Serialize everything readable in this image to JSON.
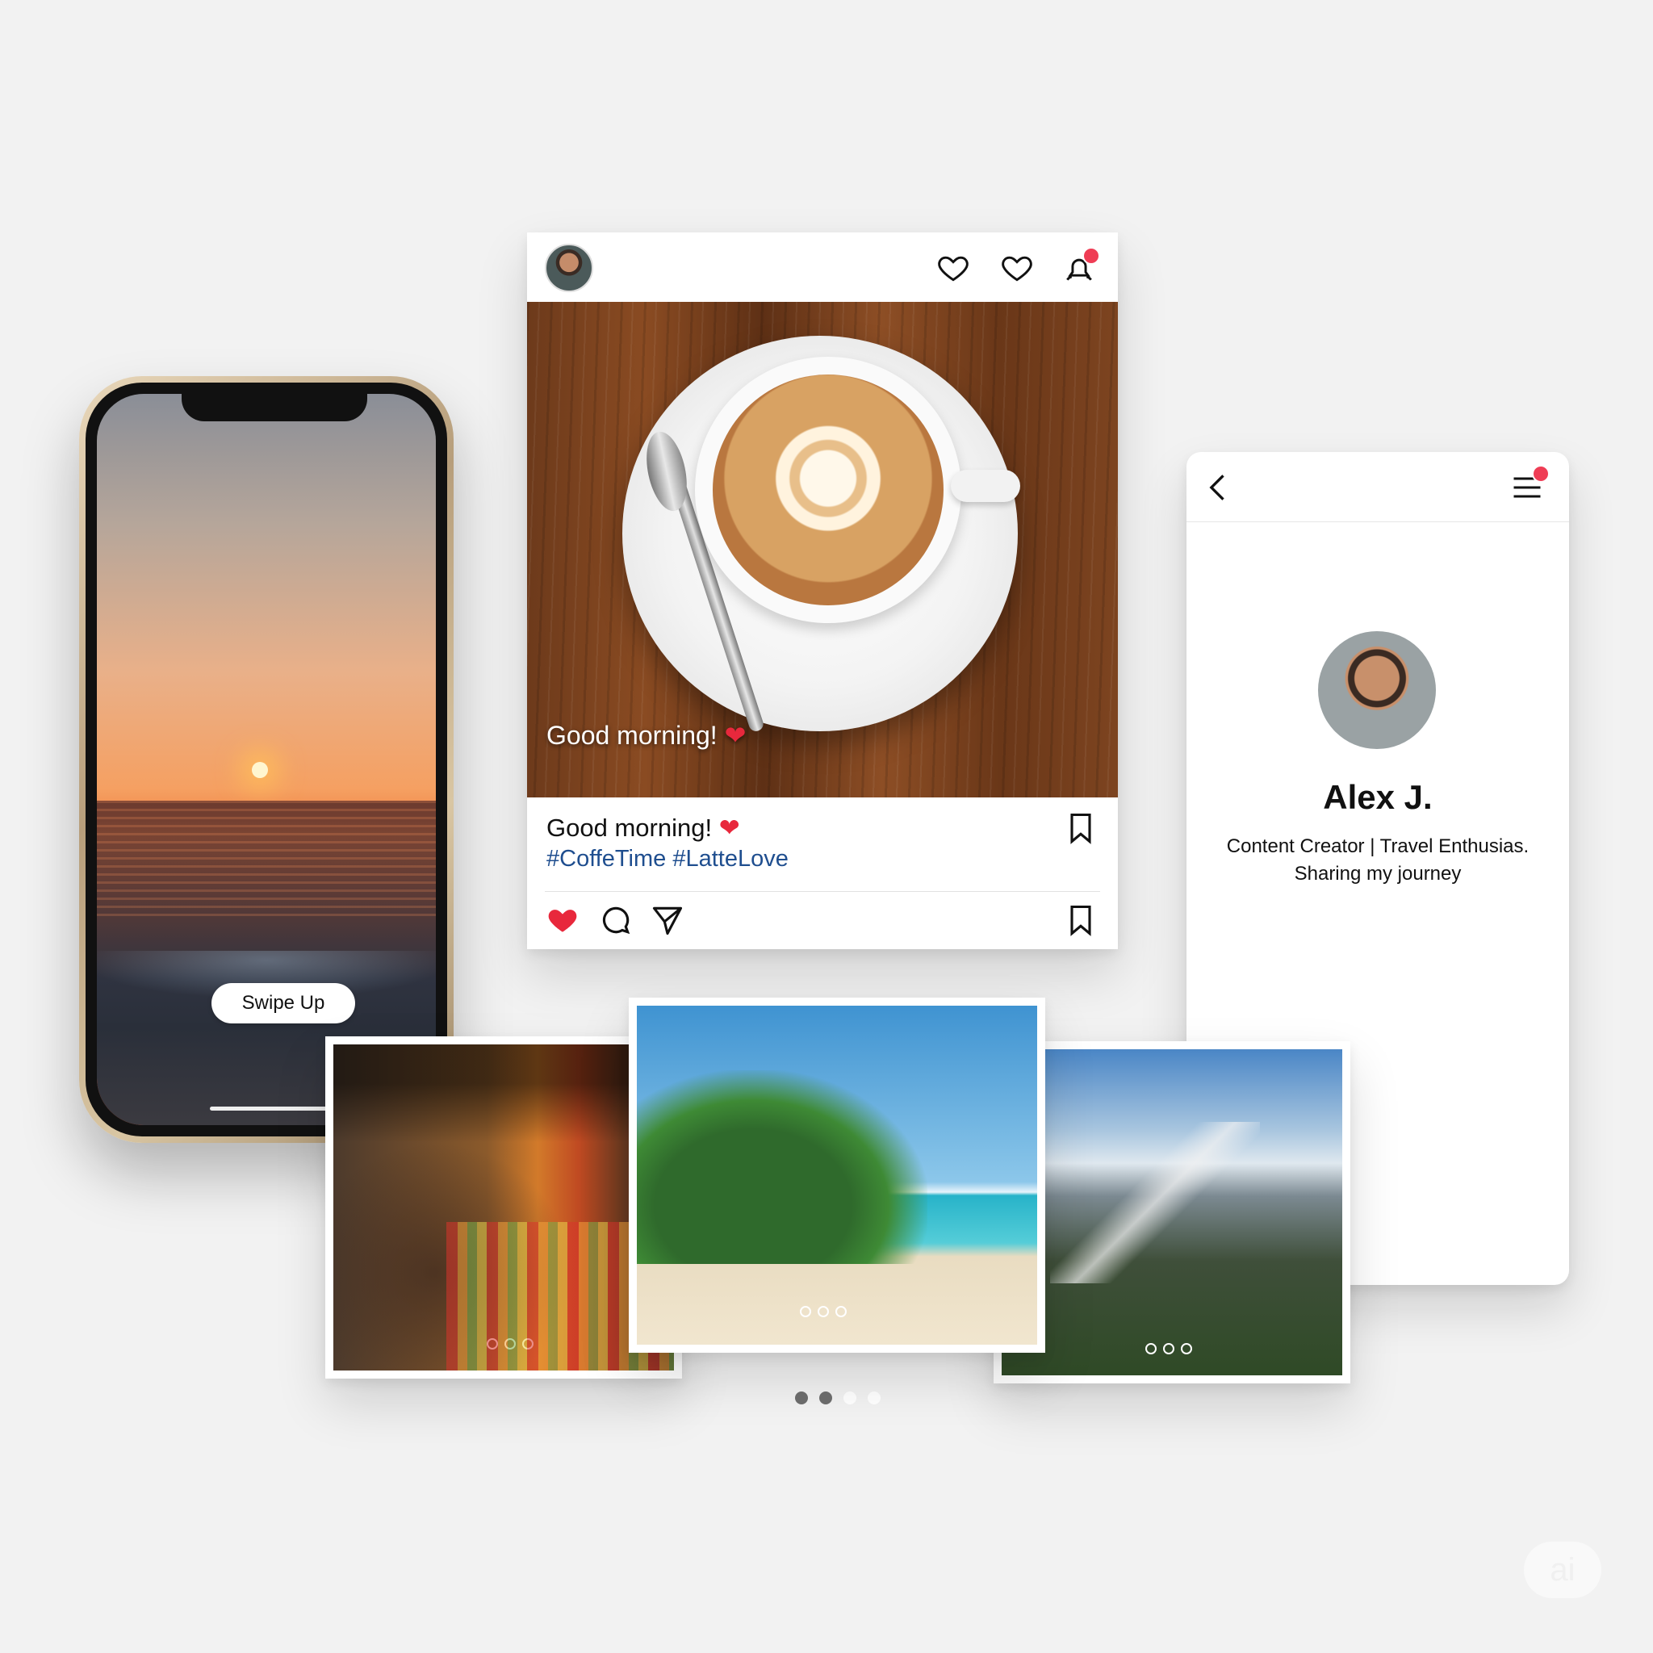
{
  "phone": {
    "swipe_label": "Swipe Up"
  },
  "post": {
    "header_icons": [
      "avatar",
      "heart-icon",
      "heart-icon",
      "notification-bell-icon"
    ],
    "image_overlay_caption": "Good morning!",
    "caption": "Good morning!",
    "hashtags": "#CoffeTime #LatteLove",
    "liked": true,
    "accent_color": "#e8283c",
    "hashtag_color": "#1f4e8f"
  },
  "profile": {
    "name": "Alex J.",
    "bio_line1": "Content Creator | Travel Enthusias.",
    "bio_line2": "Sharing my journey"
  },
  "gallery": {
    "items": [
      {
        "name": "market-photo"
      },
      {
        "name": "beach-photo"
      },
      {
        "name": "mountain-photo"
      }
    ]
  },
  "pager": {
    "total": 4,
    "active": 2
  },
  "watermark": "ai"
}
